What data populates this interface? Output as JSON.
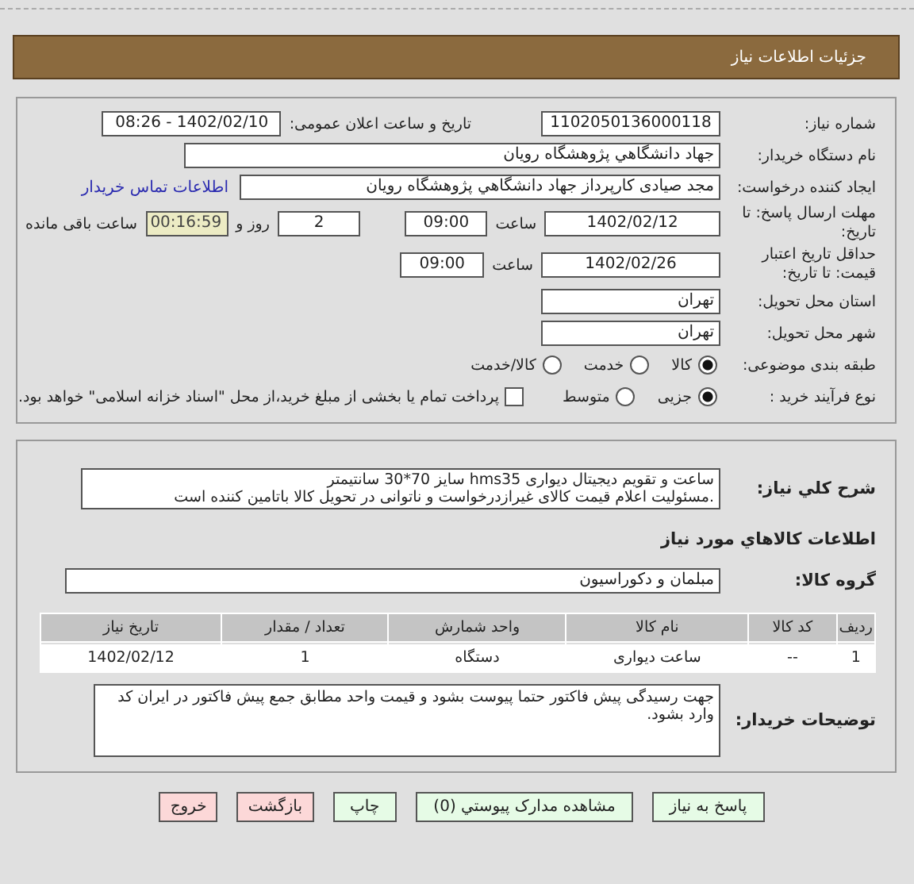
{
  "header": {
    "title": "جزئیات اطلاعات نیاز"
  },
  "details": {
    "need_number": {
      "label": "شماره نیاز:",
      "value": "1102050136000118"
    },
    "announce": {
      "label": "تاریخ و ساعت اعلان عمومی:",
      "value": "1402/02/10 - 08:26"
    },
    "buyer_org": {
      "label": "نام دستگاه خریدار:",
      "value": "جهاد دانشگاهي پژوهشگاه رويان"
    },
    "creator": {
      "label": "ایجاد کننده درخواست:",
      "value": "مجد صیادی کارپرداز جهاد دانشگاهي پژوهشگاه رويان",
      "link": "اطلاعات تماس خریدار"
    },
    "deadline": {
      "label": "مهلت ارسال پاسخ: تا تاریخ:",
      "date": "1402/02/12",
      "time_label": "ساعت",
      "time": "09:00",
      "days": "2",
      "days_label": "روز و",
      "remaining": "00:16:59",
      "remaining_label": "ساعت باقی مانده"
    },
    "validity": {
      "label": "حداقل تاریخ اعتبار قیمت: تا تاریخ:",
      "date": "1402/02/26",
      "time_label": "ساعت",
      "time": "09:00"
    },
    "province": {
      "label": "استان محل تحویل:",
      "value": "تهران"
    },
    "city": {
      "label": "شهر محل تحویل:",
      "value": "تهران"
    },
    "classification": {
      "label": "طبقه بندی موضوعی:",
      "options": [
        {
          "label": "کالا",
          "selected": true
        },
        {
          "label": "خدمت",
          "selected": false
        },
        {
          "label": "کالا/خدمت",
          "selected": false
        }
      ]
    },
    "process": {
      "label": "نوع فرآیند خرید :",
      "options": [
        {
          "label": "جزیی",
          "selected": true
        },
        {
          "label": "متوسط",
          "selected": false
        }
      ],
      "treasury": {
        "label": "پرداخت تمام یا بخشی از مبلغ خرید،از محل \"اسناد خزانه اسلامی\" خواهد بود.",
        "checked": false
      }
    }
  },
  "needs": {
    "summary": {
      "label": "شرح کلي نياز:",
      "lines": [
        "ساعت و تقویم دیجیتال دیواری hms35 سایز 70*30 سانتیمتر",
        ".مسئولیت اعلام قیمت کالای غیرازدرخواست و ناتوانی در تحویل کالا باتامین کننده است"
      ]
    },
    "goods_heading": "اطلاعات کالاهاي مورد نياز",
    "group": {
      "label": "گروه کالا:",
      "value": "مبلمان و دکوراسیون"
    },
    "table": {
      "columns": [
        "ردیف",
        "کد کالا",
        "نام کالا",
        "واحد شمارش",
        "تعداد / مقدار",
        "تاریخ نیاز"
      ],
      "rows": [
        [
          "1",
          "--",
          "ساعت دیواری",
          "دستگاه",
          "1",
          "1402/02/12"
        ]
      ]
    },
    "buyer_notes": {
      "label": "توضیحات خریدار:",
      "value": "جهت رسیدگی پیش فاکتور حتما پیوست بشود و قیمت واحد مطابق جمع پیش فاکتور در ایران کد وارد بشود."
    }
  },
  "buttons": [
    {
      "label": "پاسخ به نیاز",
      "kind": "action"
    },
    {
      "label": "مشاهده مدارک پیوستي (0)",
      "kind": "action"
    },
    {
      "label": "چاپ",
      "kind": "action"
    },
    {
      "label": "بازگشت",
      "kind": "exit"
    },
    {
      "label": "خروج",
      "kind": "exit"
    }
  ]
}
